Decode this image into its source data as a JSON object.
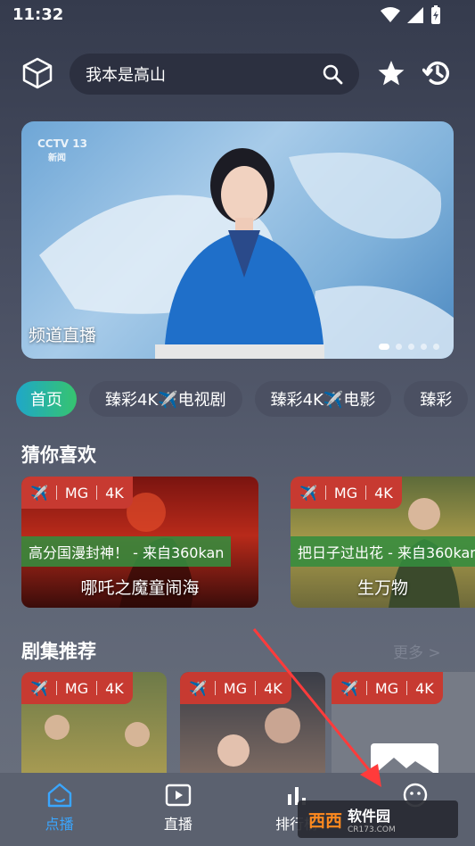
{
  "status": {
    "time": "11:32"
  },
  "search": {
    "text": "我本是高山"
  },
  "banner": {
    "caption": "频道直播",
    "logo_text": "CCTV 13",
    "logo_sub": "新闻"
  },
  "chips": [
    {
      "label": "首页"
    },
    {
      "label": "臻彩4K✈️电视剧"
    },
    {
      "label": "臻彩4K✈️电影"
    },
    {
      "label": "臻彩"
    }
  ],
  "guess": {
    "title": "猜你喜欢",
    "cards": [
      {
        "badge": [
          "✈️",
          "MG",
          "4K"
        ],
        "source": "高分国漫封神！ - 来自360kan",
        "title": "哪吒之魔童闹海"
      },
      {
        "badge": [
          "✈️",
          "MG",
          "4K"
        ],
        "source": "把日子过出花 - 来自360kan",
        "title": "生万物"
      }
    ]
  },
  "series": {
    "title": "剧集推荐",
    "more": "更多 >",
    "cards": [
      {
        "badge": [
          "✈️",
          "MG",
          "4K"
        ]
      },
      {
        "badge": [
          "✈️",
          "MG",
          "4K"
        ]
      },
      {
        "badge": [
          "✈️",
          "MG",
          "4K"
        ]
      }
    ]
  },
  "nav": [
    {
      "label": "点播",
      "icon": "home-icon"
    },
    {
      "label": "直播",
      "icon": "play-icon"
    },
    {
      "label": "排行榜",
      "icon": "rank-icon"
    },
    {
      "label": "",
      "icon": "face-icon"
    }
  ],
  "watermark": {
    "brand": "西西",
    "text": "软件园",
    "sub": "CR173.COM"
  },
  "colors": {
    "accent": "#3aa6ff",
    "badge": "#c73a31",
    "source_tag": "#348c3e"
  }
}
